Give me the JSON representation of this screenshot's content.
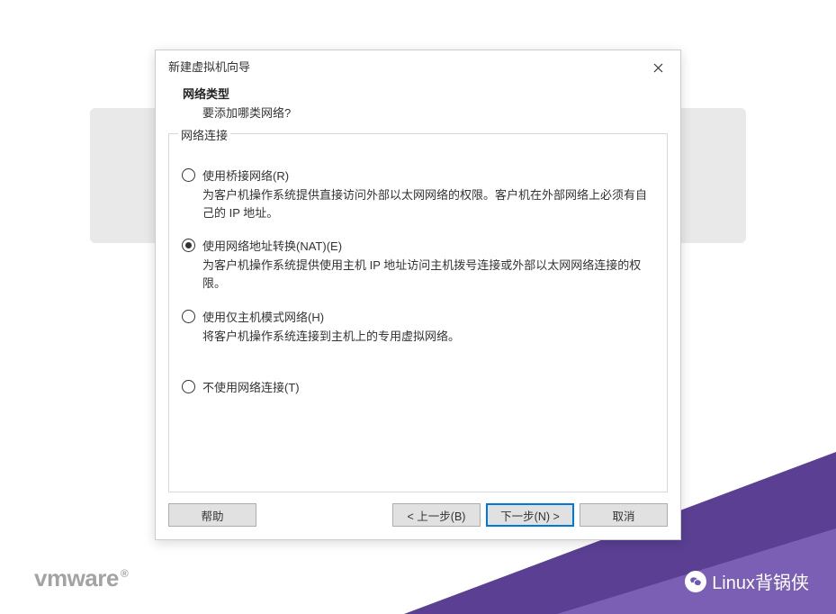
{
  "dialog": {
    "title": "新建虚拟机向导",
    "header_title": "网络类型",
    "header_subtitle": "要添加哪类网络?",
    "fieldset_legend": "网络连接",
    "options": [
      {
        "label": "使用桥接网络(R)",
        "description": "为客户机操作系统提供直接访问外部以太网网络的权限。客户机在外部网络上必须有自己的 IP 地址。",
        "checked": false
      },
      {
        "label": "使用网络地址转换(NAT)(E)",
        "description": "为客户机操作系统提供使用主机 IP 地址访问主机拨号连接或外部以太网网络连接的权限。",
        "checked": true
      },
      {
        "label": "使用仅主机模式网络(H)",
        "description": "将客户机操作系统连接到主机上的专用虚拟网络。",
        "checked": false
      },
      {
        "label": "不使用网络连接(T)",
        "description": "",
        "checked": false
      }
    ],
    "buttons": {
      "help": "帮助",
      "back": "< 上一步(B)",
      "next": "下一步(N) >",
      "cancel": "取消"
    }
  },
  "branding": {
    "logo": "vmware",
    "watermark": "Linux背锅侠"
  }
}
